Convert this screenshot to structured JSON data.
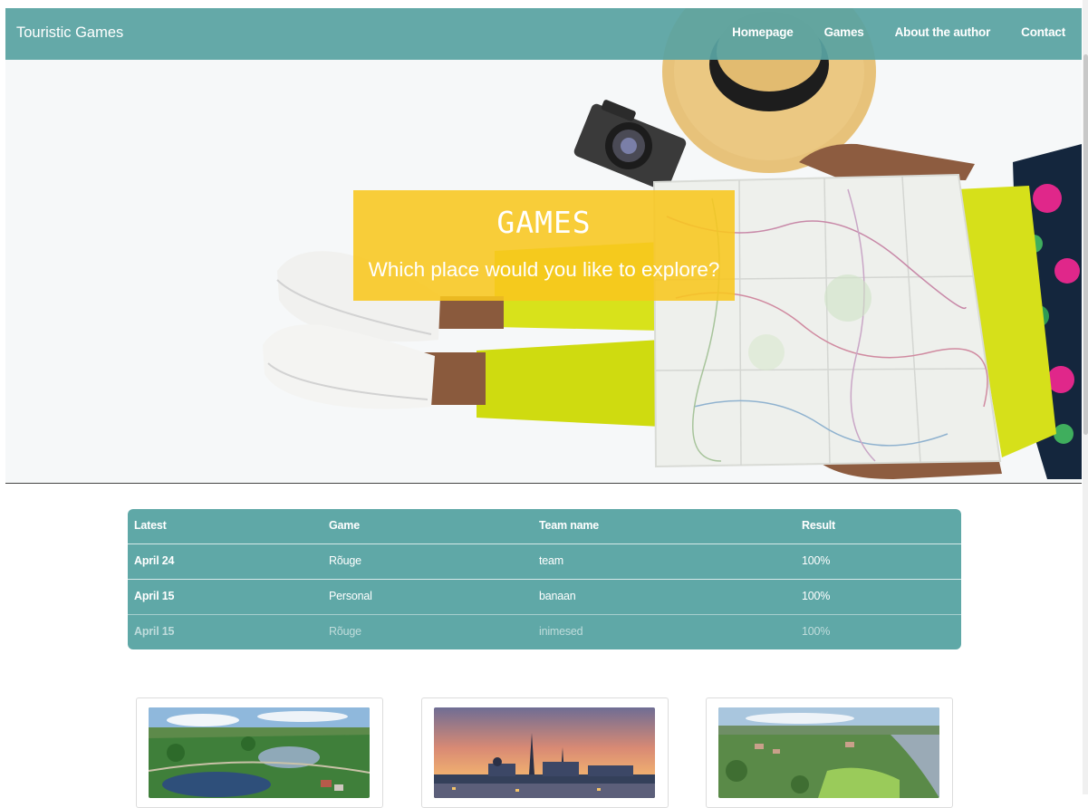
{
  "navbar": {
    "brand": "Touristic Games",
    "links": [
      "Homepage",
      "Games",
      "About the author",
      "Contact"
    ]
  },
  "hero": {
    "title": "GAMES",
    "subtitle": "Which place would you like to explore?",
    "box_color": "#f8c61e"
  },
  "results": {
    "headers": [
      "Latest",
      "Game",
      "Team name",
      "Result"
    ],
    "rows": [
      [
        "April 24",
        "Rõuge",
        "team",
        "100%"
      ],
      [
        "April 15",
        "Personal",
        "banaan",
        "100%"
      ],
      [
        "April 15",
        "Rõuge",
        "inimesed",
        "100%"
      ]
    ]
  },
  "cards": [
    {
      "image": "aerial-lake-photo"
    },
    {
      "image": "old-town-sunset-photo"
    },
    {
      "image": "aerial-river-town-photo"
    }
  ],
  "colors": {
    "accent": "#5fa8a7",
    "yellow": "#f8c61e",
    "text_on_accent": "#ffffff"
  }
}
